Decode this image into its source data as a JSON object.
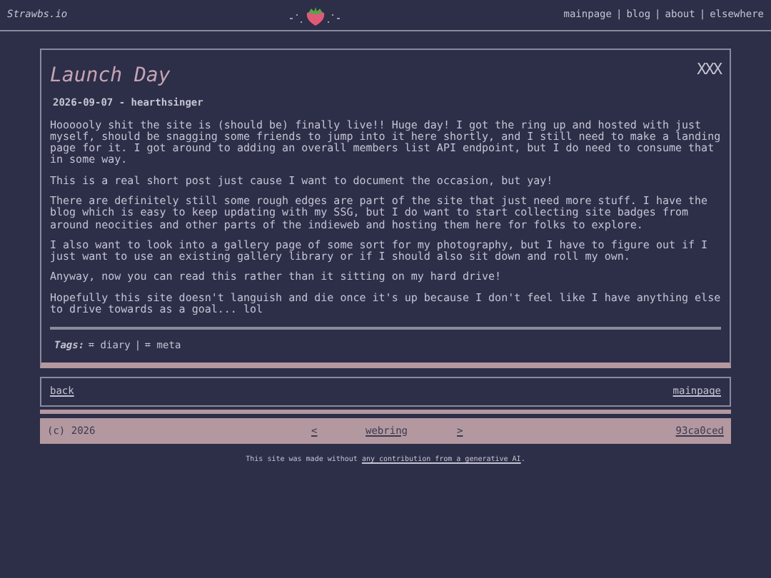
{
  "header": {
    "site_name": "Strawbs.io",
    "nav": [
      {
        "label": "mainpage"
      },
      {
        "label": "blog"
      },
      {
        "label": "about"
      },
      {
        "label": "elsewhere"
      }
    ],
    "separator": "|"
  },
  "post": {
    "title": "Launch Day",
    "mark": "XXX",
    "meta": "2026-09-07 - hearthsinger",
    "paragraphs": [
      "Hoooooly shit the site is (should be) finally live!! Huge day! I got the ring up and hosted with just myself, should be snagging some friends to jump into it here shortly, and I still need to make a landing page for it. I got around to adding an overall members list API endpoint, but I do need to consume that in some way.",
      "This is a real short post just cause I want to document the occasion, but yay!",
      "There are definitely still some rough edges are part of the site that just need more stuff. I have the blog which is easy to keep updating with my SSG, but I do want to start collecting site badges from around neocities and other parts of the indieweb and hosting them here for folks to explore.",
      "I also want to look into a gallery page of some sort for my photography, but I have to figure out if I just want to use an existing gallery library or if I should also sit down and roll my own.",
      "Anyway, now you can read this rather than it sitting on my hard drive!",
      "Hopefully this site doesn't languish and die once it's up because I don't feel like I have anything else to drive towards as a goal... lol"
    ],
    "tags_label": "Tags:",
    "tags": [
      "⌗ diary",
      "⌗ meta"
    ],
    "tag_separator": "|"
  },
  "post_nav": {
    "back": "back",
    "mainpage": "mainpage"
  },
  "footer": {
    "copyright": "(c) 2026",
    "prev": "<",
    "webring": "webring",
    "next": ">",
    "commit": "93ca0ced"
  },
  "credit": {
    "text": "This site was made without ",
    "link": "any contribution from a generative AI",
    "end": "."
  }
}
